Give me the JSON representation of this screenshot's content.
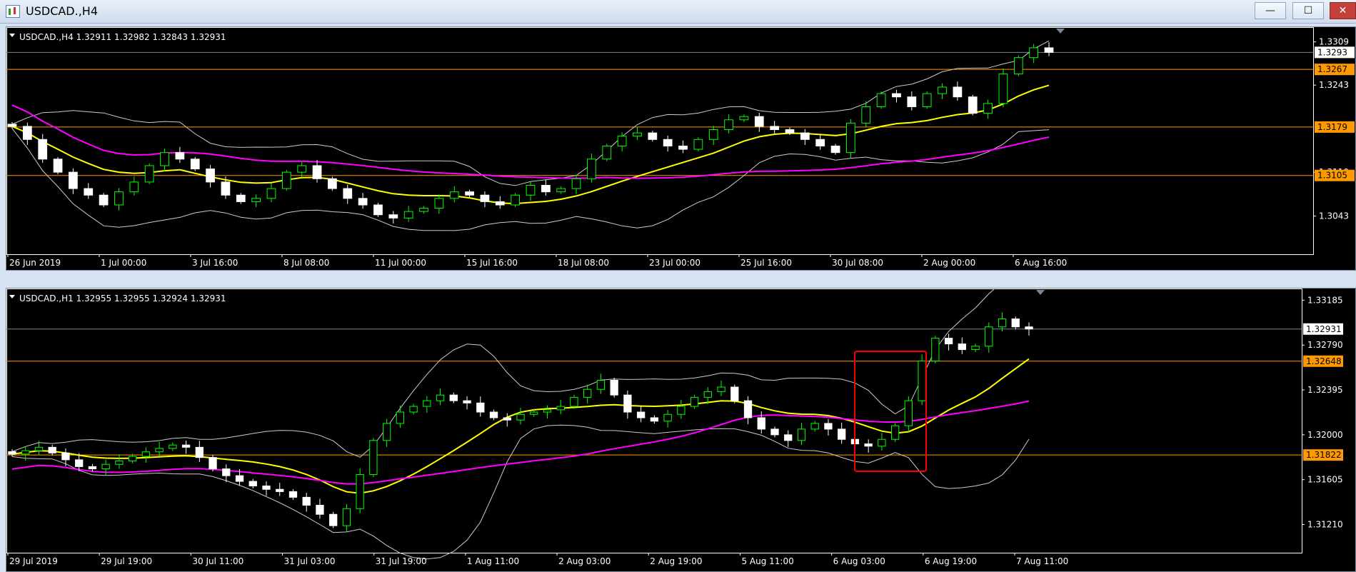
{
  "window": {
    "title": "USDCAD.,H4",
    "buttons": {
      "minimize": "—",
      "maximize": "☐",
      "close": "✕"
    }
  },
  "colors": {
    "background": "#000000",
    "axis": "#ffffff",
    "bull": "#00ff00",
    "bear": "#ffffff",
    "ma_fast": "#ffff00",
    "ma_slow": "#ff00ff",
    "bands": "#cccccc",
    "levels": "#ff9900",
    "marker": "#ff0000"
  },
  "chart_h4": {
    "header": "USDCAD.,H4  1.32911 1.32982 1.32843 1.32931",
    "price_labels": [
      "1.3309",
      "1.3243",
      "1.3043",
      "1.3110"
    ],
    "current_price": "1.3293",
    "level_labels": [
      "1.3267",
      "1.3179",
      "1.3105"
    ],
    "time_labels": [
      "26 Jun 2019",
      "1 Jul 00:00",
      "3 Jul 16:00",
      "8 Jul 08:00",
      "11 Jul 00:00",
      "15 Jul 16:00",
      "18 Jul 08:00",
      "23 Jul 00:00",
      "25 Jul 16:00",
      "30 Jul 08:00",
      "2 Aug 00:00",
      "6 Aug 16:00"
    ]
  },
  "chart_h1": {
    "header": "USDCAD.,H1  1.32955 1.32955 1.32924 1.32931",
    "price_labels": [
      "1.33185",
      "1.32790",
      "1.32395",
      "1.32000",
      "1.31605",
      "1.31210"
    ],
    "current_price": "1.32931",
    "level_labels": [
      "1.32648",
      "1.31822"
    ],
    "time_labels": [
      "29 Jul 2019",
      "29 Jul 19:00",
      "30 Jul 11:00",
      "31 Jul 03:00",
      "31 Jul 19:00",
      "1 Aug 11:00",
      "2 Aug 03:00",
      "2 Aug 19:00",
      "5 Aug 11:00",
      "6 Aug 03:00",
      "6 Aug 19:00",
      "7 Aug 11:00"
    ]
  },
  "chart_data": [
    {
      "type": "candlestick",
      "title": "USDCAD.,H4",
      "ylim": [
        1.3,
        1.3325
      ],
      "levels": [
        1.3267,
        1.3179,
        1.3105
      ],
      "current": 1.3293,
      "series": [
        {
          "name": "close",
          "values": [
            1.318,
            1.316,
            1.313,
            1.311,
            1.3085,
            1.3075,
            1.306,
            1.308,
            1.3095,
            1.312,
            1.314,
            1.313,
            1.3115,
            1.3095,
            1.3075,
            1.3065,
            1.307,
            1.3085,
            1.311,
            1.312,
            1.31,
            1.3085,
            1.307,
            1.306,
            1.3045,
            1.304,
            1.305,
            1.3055,
            1.307,
            1.308,
            1.3075,
            1.3065,
            1.306,
            1.3075,
            1.309,
            1.308,
            1.3085,
            1.31,
            1.313,
            1.315,
            1.3165,
            1.317,
            1.316,
            1.315,
            1.3145,
            1.316,
            1.3175,
            1.319,
            1.3195,
            1.318,
            1.3175,
            1.317,
            1.316,
            1.315,
            1.314,
            1.3185,
            1.321,
            1.323,
            1.3225,
            1.321,
            1.323,
            1.324,
            1.3225,
            1.32,
            1.3215,
            1.326,
            1.3285,
            1.33,
            1.3293
          ]
        }
      ]
    },
    {
      "type": "candlestick",
      "title": "USDCAD.,H1",
      "ylim": [
        1.3105,
        1.3325
      ],
      "levels": [
        1.32648,
        1.31822
      ],
      "current": 1.32931,
      "series": [
        {
          "name": "close",
          "values": [
            1.3183,
            1.3186,
            1.3189,
            1.3184,
            1.3178,
            1.3172,
            1.317,
            1.3174,
            1.3177,
            1.3181,
            1.3185,
            1.3188,
            1.3191,
            1.3189,
            1.318,
            1.317,
            1.3164,
            1.3159,
            1.3155,
            1.3152,
            1.315,
            1.3145,
            1.3138,
            1.313,
            1.312,
            1.3135,
            1.3165,
            1.3195,
            1.321,
            1.322,
            1.3225,
            1.323,
            1.3235,
            1.323,
            1.3228,
            1.322,
            1.3215,
            1.3213,
            1.3218,
            1.322,
            1.3222,
            1.3225,
            1.3233,
            1.324,
            1.3248,
            1.3235,
            1.322,
            1.3215,
            1.3212,
            1.3218,
            1.3225,
            1.3233,
            1.3238,
            1.3242,
            1.323,
            1.3215,
            1.3205,
            1.32,
            1.3195,
            1.3205,
            1.321,
            1.3205,
            1.3196,
            1.3192,
            1.319,
            1.3196,
            1.3208,
            1.323,
            1.3265,
            1.3285,
            1.328,
            1.3275,
            1.3278,
            1.3295,
            1.3302,
            1.3295,
            1.32931
          ]
        }
      ]
    }
  ]
}
